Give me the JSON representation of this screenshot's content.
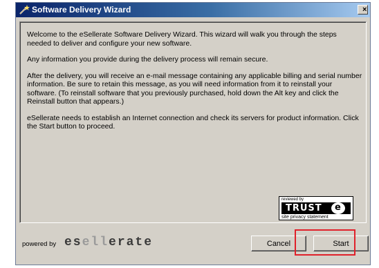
{
  "window": {
    "title": "Software Delivery Wizard",
    "close_glyph": "×"
  },
  "content": {
    "paragraphs": [
      "Welcome to the eSellerate Software Delivery Wizard. This wizard will walk you through the steps needed to deliver and configure your new software.",
      "Any information you provide during the delivery process will remain secure.",
      "After the delivery, you will receive an e-mail message containing any applicable billing and serial number information. Be sure to retain this message, as you will need information from it to reinstall your software. (To reinstall software that you previously purchased, hold down the Alt key and click the Reinstall button that appears.)",
      "eSellerate needs to establish an Internet connection and check its servers for product information. Click the Start button to proceed."
    ]
  },
  "trust_badge": {
    "top_text": "reviewed by",
    "logo_text": "TRUST",
    "logo_mark": "e",
    "bottom_text": "site privacy statement"
  },
  "footer": {
    "powered_by": "powered by",
    "brand_part1": "es",
    "brand_part2": "ell",
    "brand_part3": "erate"
  },
  "buttons": {
    "cancel": "Cancel",
    "start": "Start"
  },
  "colors": {
    "highlight": "#e0202a",
    "titlebar_start": "#0a246a",
    "titlebar_end": "#a6caf0",
    "window_bg": "#d4d0c8"
  }
}
